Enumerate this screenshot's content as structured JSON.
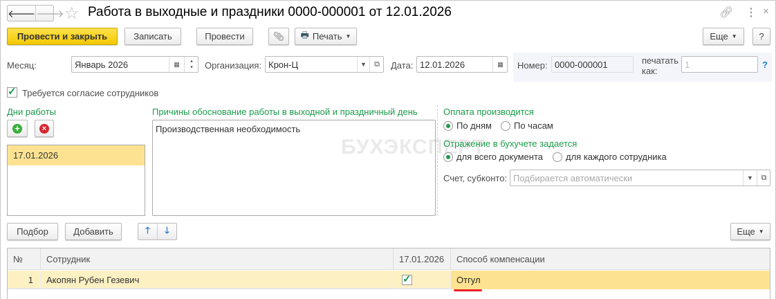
{
  "window": {
    "title": "Работа в выходные и праздники 0000-000001 от 12.01.2026",
    "watermark": "БУХЭКСПЕРТ"
  },
  "toolbar": {
    "post_close": "Провести и закрыть",
    "save": "Записать",
    "post": "Провести",
    "print": "Печать",
    "more": "Еще",
    "help": "?"
  },
  "fields": {
    "month_label": "Месяц:",
    "month_value": "Январь 2026",
    "org_label": "Организация:",
    "org_value": "Крон-Ц",
    "date_label": "Дата:",
    "date_value": "12.01.2026",
    "number_label": "Номер:",
    "number_value": "0000-000001",
    "print_as_label1": "печатать",
    "print_as_label2": "как:",
    "print_as_placeholder": "1",
    "print_as_help": "?"
  },
  "consent": {
    "label": "Требуется согласие сотрудников",
    "checked": true
  },
  "work_days": {
    "label": "Дни работы",
    "items": [
      "17.01.2026"
    ]
  },
  "reasons": {
    "label": "Причины обоснование работы в выходной и праздничный день",
    "value": "Производственная необходимость"
  },
  "payment": {
    "label": "Оплата производится",
    "options": [
      "По дням",
      "По часам"
    ],
    "selected": "По дням"
  },
  "accounting": {
    "label": "Отражение в бухучете задается",
    "options": [
      "для всего документа",
      "для каждого сотрудника"
    ],
    "selected": "для всего документа"
  },
  "account": {
    "label": "Счет, субконто:",
    "placeholder": "Подбирается автоматически"
  },
  "table_toolbar": {
    "pick": "Подбор",
    "add": "Добавить",
    "more": "Еще"
  },
  "table": {
    "columns": [
      "№",
      "Сотрудник",
      "17.01.2026",
      "Способ компенсации"
    ],
    "rows": [
      {
        "n": "1",
        "employee": "Акопян Рубен Гезевич",
        "day_checked": true,
        "compensation": "Отгул"
      }
    ]
  },
  "colors": {
    "accent": "#f3c800",
    "green": "#1a9a4a",
    "selection": "#fde391",
    "row": "#fdf1c4"
  }
}
